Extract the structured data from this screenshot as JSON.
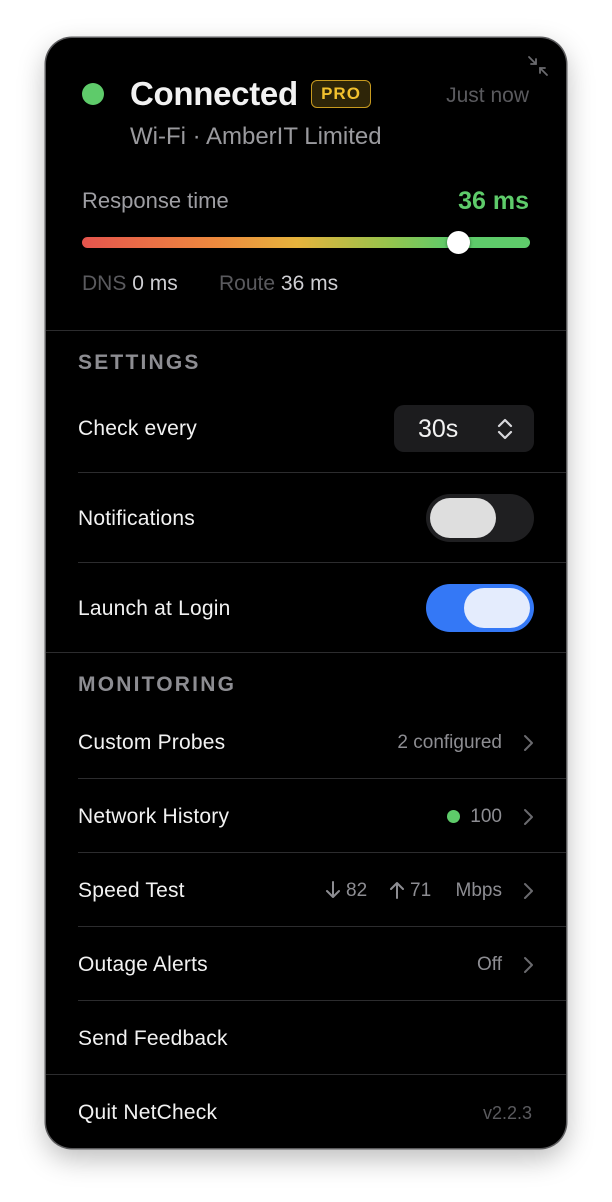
{
  "header": {
    "status": "Connected",
    "badge": "PRO",
    "timestamp": "Just now",
    "network": "Wi-Fi · AmberIT Limited"
  },
  "response": {
    "label": "Response time",
    "value": "36 ms",
    "level": 0.84,
    "dns_key": "DNS",
    "dns_value": "0 ms",
    "route_key": "Route",
    "route_value": "36 ms"
  },
  "settings": {
    "heading": "SETTINGS",
    "check_every_label": "Check every",
    "check_every_value": "30s",
    "notifications_label": "Notifications",
    "notifications_on": false,
    "launch_label": "Launch at Login",
    "launch_on": true
  },
  "monitoring": {
    "heading": "MONITORING",
    "custom_probes_label": "Custom Probes",
    "custom_probes_value": "2 configured",
    "network_history_label": "Network History",
    "network_history_value": "100",
    "speed_test_label": "Speed Test",
    "speed_down": "82",
    "speed_up": "71",
    "speed_unit": "Mbps",
    "outage_label": "Outage Alerts",
    "outage_value": "Off"
  },
  "footer": {
    "feedback_label": "Send Feedback",
    "quit_label": "Quit NetCheck",
    "version": "v2.2.3"
  },
  "colors": {
    "accent": "#3478f6",
    "status_green": "#5ecb6a",
    "pro_gold": "#f2c12e"
  },
  "icons": [
    "collapse-icon",
    "chevron-up-down-icon",
    "chevron-right-icon",
    "arrow-down-icon",
    "arrow-up-icon"
  ]
}
